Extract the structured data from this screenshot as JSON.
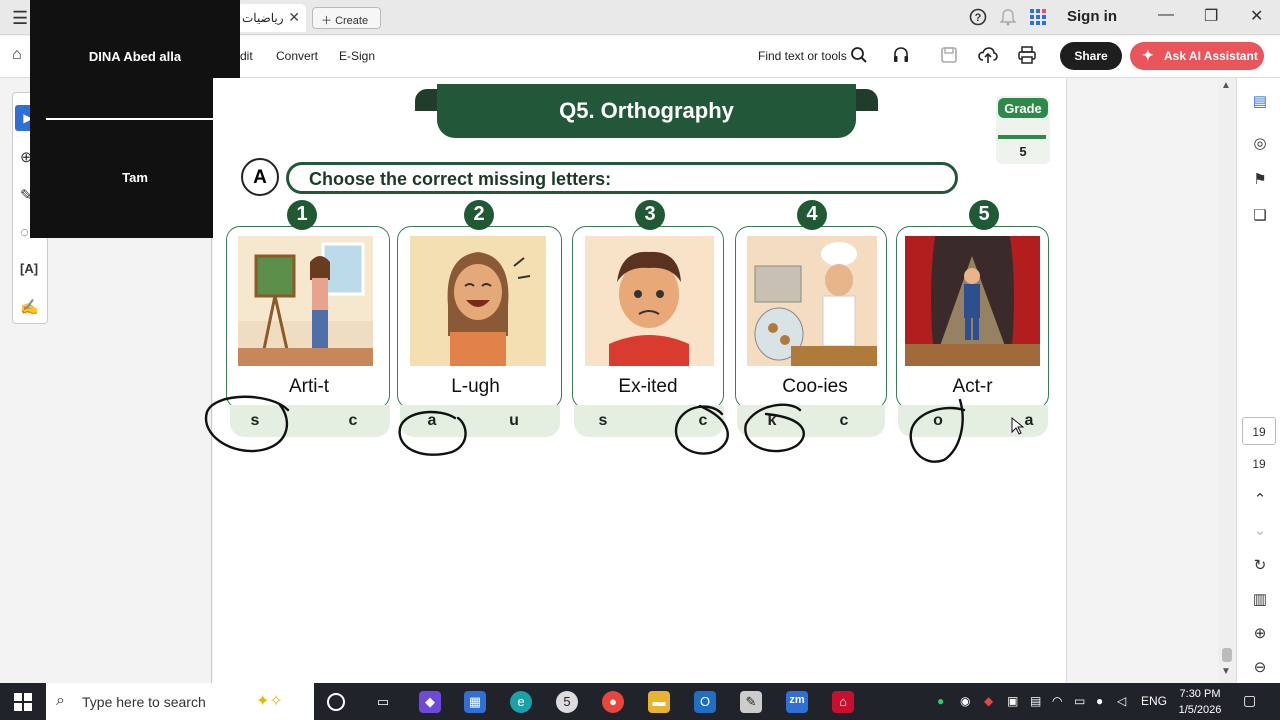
{
  "titlebar": {
    "tab_title": "رياضيات",
    "tab_close": "✕",
    "create_label": "Create",
    "help_icon": "?",
    "bell_icon": "🔔",
    "apps_icon": "⁘",
    "sign_in": "Sign in",
    "minimize": "—",
    "restore": "❐",
    "close": "✕"
  },
  "toolbar": {
    "edit_partial": "dit",
    "convert": "Convert",
    "esign": "E-Sign",
    "find": "Find text or tools",
    "share": "Share",
    "ai": "Ask AI Assistant"
  },
  "video": {
    "participant1": "DINA Abed alla",
    "participant2": "Tam"
  },
  "document": {
    "question_title": "Q5. Orthography",
    "grade_label": "Grade",
    "grade_value": "5",
    "section_letter": "A",
    "instruction": "Choose the correct missing letters:",
    "items": [
      {
        "number": "1",
        "word": "Arti-t",
        "options": [
          "s",
          "c"
        ],
        "image": "artist-painting-scene",
        "circled": "s"
      },
      {
        "number": "2",
        "word": "L-ugh",
        "options": [
          "a",
          "u"
        ],
        "image": "laughing-girl",
        "circled": "a"
      },
      {
        "number": "3",
        "word": "Ex-ited",
        "options": [
          "s",
          "c"
        ],
        "image": "worried-boy",
        "circled": "c"
      },
      {
        "number": "4",
        "word": "Coo-ies",
        "options": [
          "k",
          "c"
        ],
        "image": "chef-girl-cookies",
        "circled": "k"
      },
      {
        "number": "5",
        "word": "Act-r",
        "options": [
          "o",
          "a"
        ],
        "image": "actor-on-stage",
        "circled": "o"
      }
    ]
  },
  "right_panel": {
    "page_current": "19",
    "page_total": "19"
  },
  "taskbar": {
    "search_placeholder": "Type here to search",
    "language": "ENG",
    "time": "7:30 PM",
    "date": "1/5/2026",
    "chrome_badge": "5"
  },
  "colors": {
    "dark_green": "#23573a",
    "grade_green": "#2d8a4a",
    "ai_red": "#e9555b",
    "option_bg": "#e4efe2"
  }
}
